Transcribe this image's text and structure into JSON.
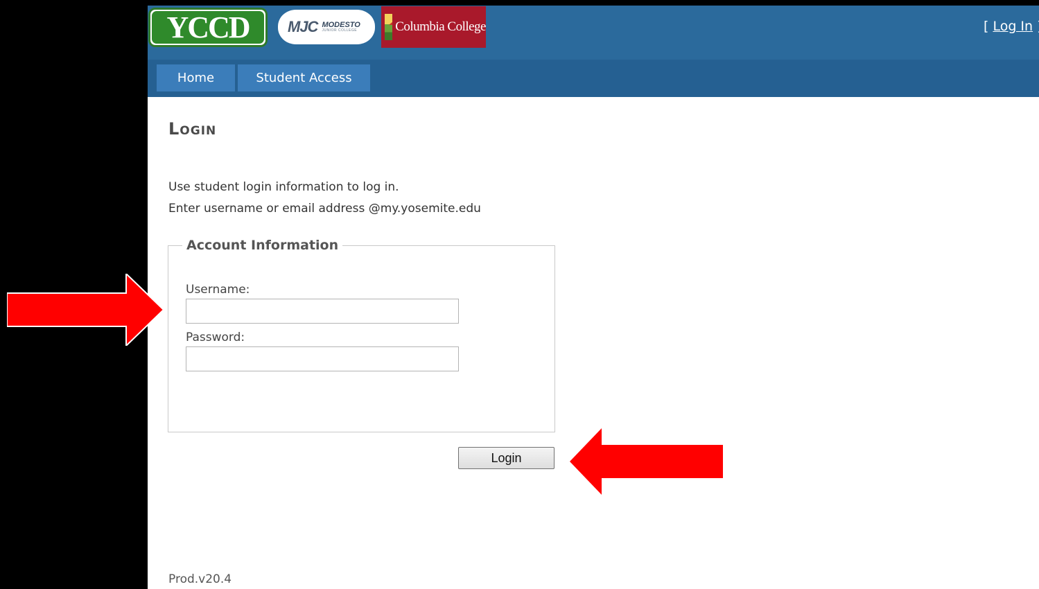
{
  "header": {
    "logos": {
      "yccd": "YCCD",
      "mjc_mark": "MJC",
      "mjc_name": "MODESTO",
      "mjc_sub": "JUNIOR COLLEGE",
      "columbia": "Columbia College"
    },
    "login_link_open": "[ ",
    "login_link": "Log In",
    "login_link_close": " ]"
  },
  "nav": {
    "items": [
      {
        "label": "Home"
      },
      {
        "label": "Student Access"
      }
    ]
  },
  "main": {
    "title": "Login",
    "instructions": [
      "Use student login information to log in.",
      "Enter username or email address @my.yosemite.edu"
    ],
    "fieldset_legend": "Account Information",
    "username_label": "Username:",
    "username_value": "",
    "password_label": "Password:",
    "password_value": "",
    "login_button": "Login"
  },
  "footer": {
    "version": "Prod.v20.4"
  },
  "colors": {
    "header_blue": "#2b6a9c",
    "nav_tab": "#3b7dba",
    "annotation_arrow": "#ff0000"
  }
}
